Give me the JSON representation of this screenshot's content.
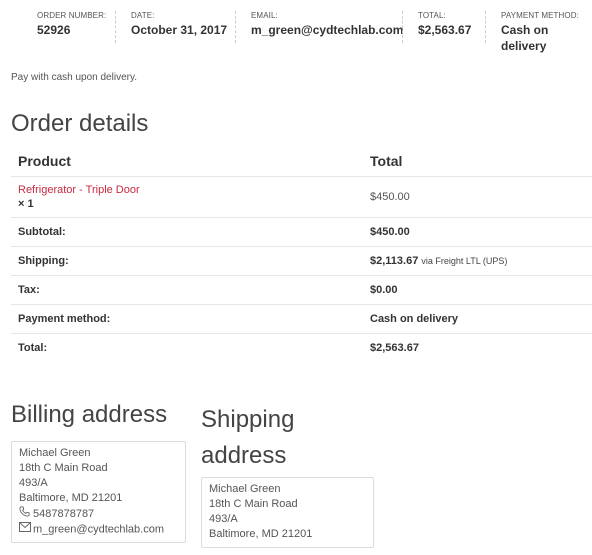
{
  "overview": {
    "order_number": {
      "label": "ORDER NUMBER:",
      "value": "52926"
    },
    "date": {
      "label": "DATE:",
      "value": "October 31, 2017"
    },
    "email": {
      "label": "EMAIL:",
      "value": "m_green@cydtechlab.com"
    },
    "total": {
      "label": "TOTAL:",
      "value": "$2,563.67"
    },
    "payment_method": {
      "label": "PAYMENT METHOD:",
      "value": "Cash on delivery"
    }
  },
  "payment_note": "Pay with cash upon delivery.",
  "order_details": {
    "title": "Order details",
    "headers": {
      "product": "Product",
      "total": "Total"
    },
    "item": {
      "name": "Refrigerator - Triple Door",
      "quantity": "× 1",
      "total": "$450.00"
    },
    "subtotal": {
      "label": "Subtotal:",
      "value": "$450.00"
    },
    "shipping": {
      "label": "Shipping:",
      "value": "$2,113.67",
      "via": "via Freight LTL (UPS)"
    },
    "tax": {
      "label": "Tax:",
      "value": "$0.00"
    },
    "payment_method": {
      "label": "Payment method:",
      "value": "Cash on delivery"
    },
    "total": {
      "label": "Total:",
      "value": "$2,563.67"
    }
  },
  "billing": {
    "title": "Billing address",
    "lines": [
      "Michael Green",
      "18th C Main Road",
      "493/A",
      "Baltimore, MD 21201"
    ],
    "phone": "5487878787",
    "email": "m_green@cydtechlab.com",
    "phone_icon": "phone-icon",
    "email_icon": "envelope-icon"
  },
  "shipping_address": {
    "title_line1": "Shipping",
    "title_line2": "address",
    "lines": [
      "Michael Green",
      "18th C Main Road",
      "493/A",
      "Baltimore, MD 21201"
    ]
  }
}
